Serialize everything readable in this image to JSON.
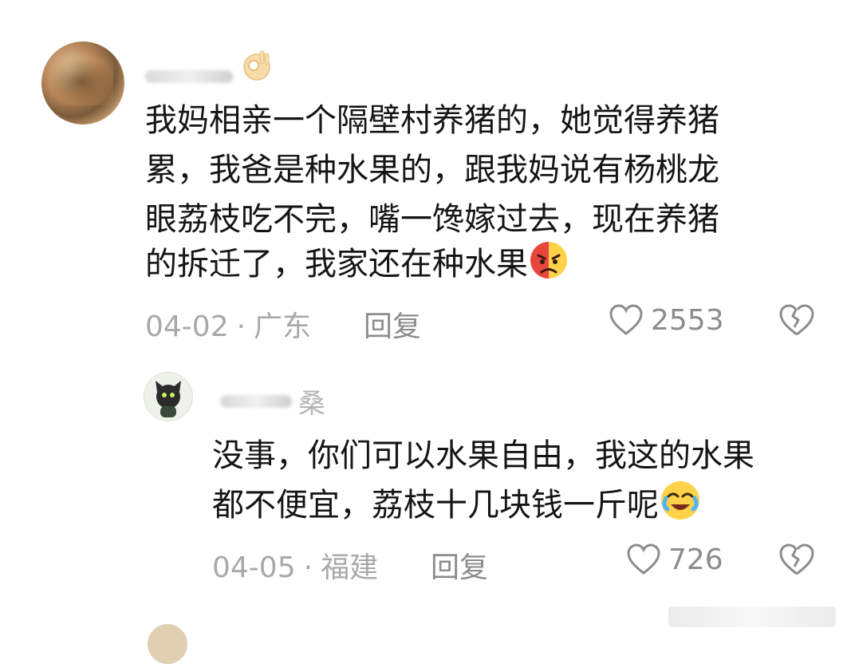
{
  "comment": {
    "text_lines": [
      "我妈相亲一个隔壁村养猪的，她觉得养猪",
      "累，我爸是种水果的，跟我妈说有杨桃龙",
      "眼荔枝吃不完，嘴一馋嫁过去，现在养猪",
      "的拆迁了，我家还在种水果"
    ],
    "end_emoji": "sad-face-emoji",
    "name_emoji": "ok-hand-emoji",
    "date": "04-02",
    "location": "广东",
    "reply_label": "回复",
    "likes": "2553"
  },
  "reply": {
    "username": "桑",
    "text_lines": [
      "没事，你们可以水果自由，我这的水果",
      "都不便宜，荔枝十几块钱一斤呢"
    ],
    "end_emoji": "laugh-cry-emoji",
    "date": "04-05",
    "location": "福建",
    "reply_label": "回复",
    "likes": "726"
  },
  "separator": "·",
  "colors": {
    "text": "#151515",
    "meta": "#a9a9a9",
    "action": "#8c8c8c"
  }
}
